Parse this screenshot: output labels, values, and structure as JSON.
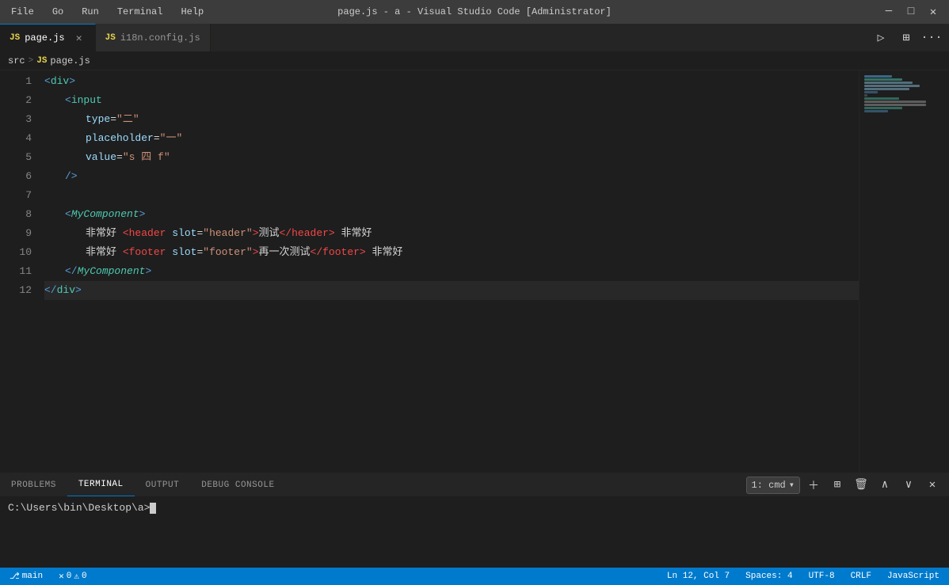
{
  "titleBar": {
    "menuItems": [
      "File",
      "Go",
      "Run",
      "Terminal",
      "Help"
    ],
    "title": "page.js - a - Visual Studio Code [Administrator]",
    "winButtons": [
      "minimize",
      "maximize",
      "close"
    ],
    "minimizeChar": "─",
    "maximizeChar": "□",
    "closeChar": "✕"
  },
  "tabs": [
    {
      "id": "page-js",
      "icon": "JS",
      "label": "page.js",
      "active": true
    },
    {
      "id": "i18n-config",
      "icon": "JS",
      "label": "i18n.config.js",
      "active": false
    }
  ],
  "tabActions": {
    "runLabel": "▷",
    "splitLabel": "⊞",
    "moreLabel": "···"
  },
  "breadcrumb": {
    "parts": [
      "src",
      "page.js"
    ]
  },
  "codeLines": [
    {
      "num": "1",
      "content": "div-open"
    },
    {
      "num": "2",
      "content": "input-open"
    },
    {
      "num": "3",
      "content": "type-attr"
    },
    {
      "num": "4",
      "content": "placeholder-attr"
    },
    {
      "num": "5",
      "content": "value-attr"
    },
    {
      "num": "6",
      "content": "self-close"
    },
    {
      "num": "7",
      "content": "blank"
    },
    {
      "num": "8",
      "content": "mycomp-open"
    },
    {
      "num": "9",
      "content": "header-slot"
    },
    {
      "num": "10",
      "content": "footer-slot"
    },
    {
      "num": "11",
      "content": "mycomp-close"
    },
    {
      "num": "12",
      "content": "div-close"
    }
  ],
  "panelTabs": [
    {
      "label": "PROBLEMS",
      "active": false
    },
    {
      "label": "TERMINAL",
      "active": true
    },
    {
      "label": "OUTPUT",
      "active": false
    },
    {
      "label": "DEBUG CONSOLE",
      "active": false
    }
  ],
  "terminalSelect": "1: cmd",
  "terminalPrompt": "C:\\Users\\bin\\Desktop\\a>",
  "statusBar": {
    "left": [],
    "right": []
  }
}
